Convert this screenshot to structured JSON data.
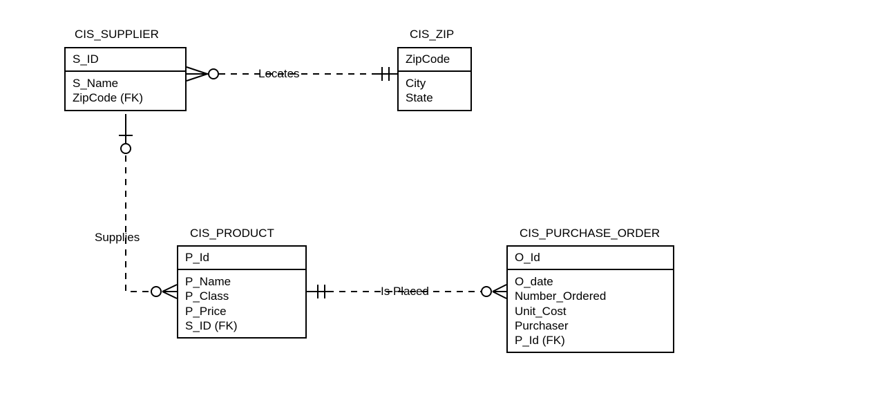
{
  "entities": {
    "supplier": {
      "title": "CIS_SUPPLIER",
      "pk": "S_ID",
      "attrs": "S_Name\nZipCode (FK)"
    },
    "zip": {
      "title": "CIS_ZIP",
      "pk": "ZipCode",
      "attrs": "City\nState"
    },
    "product": {
      "title": "CIS_PRODUCT",
      "pk": "P_Id",
      "attrs": "P_Name\nP_Class\nP_Price\nS_ID (FK)"
    },
    "order": {
      "title": "CIS_PURCHASE_ORDER",
      "pk": "O_Id",
      "attrs": "O_date\nNumber_Ordered\nUnit_Cost\nPurchaser\nP_Id (FK)"
    }
  },
  "relationships": {
    "locates": "Locates",
    "supplies": "Supplies",
    "isplaced": "Is Placed"
  }
}
